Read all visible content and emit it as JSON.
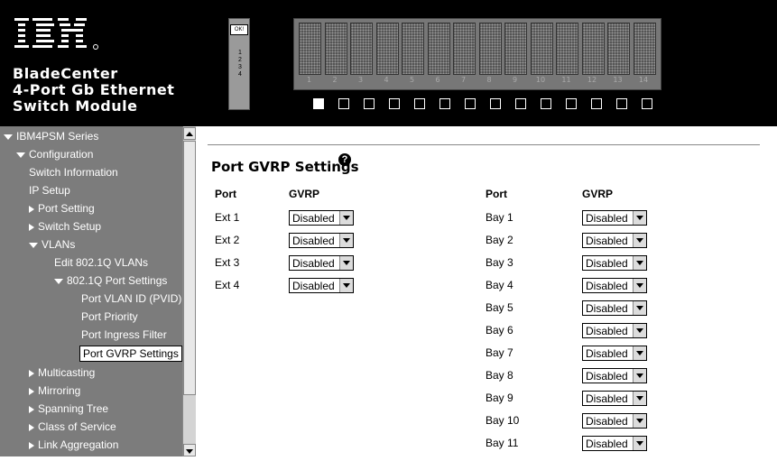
{
  "header": {
    "logo_text": "IBM",
    "title_lines": [
      "BladeCenter",
      "4-Port Gb Ethernet",
      "Switch Module"
    ],
    "module_status": "OK!",
    "module_ports": [
      "1",
      "2",
      "3",
      "4"
    ],
    "bays": [
      "1",
      "2",
      "3",
      "4",
      "5",
      "6",
      "7",
      "8",
      "9",
      "10",
      "11",
      "12",
      "13",
      "14"
    ],
    "active_bay": "1"
  },
  "sidebar": {
    "items": [
      {
        "label": "IBM4PSM Series"
      },
      {
        "label": "Configuration"
      },
      {
        "label": "Switch Information"
      },
      {
        "label": "IP Setup"
      },
      {
        "label": "Port Setting"
      },
      {
        "label": "Switch Setup"
      },
      {
        "label": "VLANs"
      },
      {
        "label": "Edit 802.1Q VLANs"
      },
      {
        "label": "802.1Q Port Settings"
      },
      {
        "label": "Port VLAN ID (PVID)"
      },
      {
        "label": "Port Priority"
      },
      {
        "label": "Port Ingress Filter"
      },
      {
        "label": "Port GVRP Settings"
      },
      {
        "label": "Multicasting"
      },
      {
        "label": "Mirroring"
      },
      {
        "label": "Spanning Tree"
      },
      {
        "label": "Class of Service"
      },
      {
        "label": "Link Aggregation"
      }
    ]
  },
  "main": {
    "title": "Port GVRP Settings",
    "help_icon_glyph": "?",
    "headers": {
      "port": "Port",
      "gvrp": "GVRP"
    },
    "left_rows": [
      {
        "port": "Ext 1",
        "gvrp": "Disabled"
      },
      {
        "port": "Ext 2",
        "gvrp": "Disabled"
      },
      {
        "port": "Ext 3",
        "gvrp": "Disabled"
      },
      {
        "port": "Ext 4",
        "gvrp": "Disabled"
      }
    ],
    "right_rows": [
      {
        "port": "Bay 1",
        "gvrp": "Disabled"
      },
      {
        "port": "Bay 2",
        "gvrp": "Disabled"
      },
      {
        "port": "Bay 3",
        "gvrp": "Disabled"
      },
      {
        "port": "Bay 4",
        "gvrp": "Disabled"
      },
      {
        "port": "Bay 5",
        "gvrp": "Disabled"
      },
      {
        "port": "Bay 6",
        "gvrp": "Disabled"
      },
      {
        "port": "Bay 7",
        "gvrp": "Disabled"
      },
      {
        "port": "Bay 8",
        "gvrp": "Disabled"
      },
      {
        "port": "Bay 9",
        "gvrp": "Disabled"
      },
      {
        "port": "Bay 10",
        "gvrp": "Disabled"
      },
      {
        "port": "Bay 11",
        "gvrp": "Disabled"
      }
    ]
  }
}
